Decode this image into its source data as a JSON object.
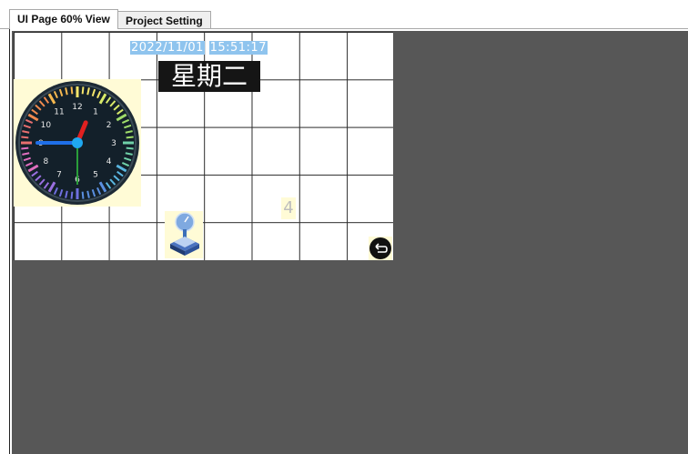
{
  "tabs": [
    {
      "label": "UI Page 60% View",
      "active": true
    },
    {
      "label": "Project Setting",
      "active": false
    }
  ],
  "canvas": {
    "date": "2022/11/01",
    "time": "15:51:17",
    "weekday": "星期二",
    "number_widget": "4",
    "clock_numerals": [
      "12",
      "1",
      "2",
      "3",
      "4",
      "5",
      "6",
      "7",
      "8",
      "9",
      "10",
      "11"
    ],
    "clock_time": {
      "hour": 12,
      "minute": 45,
      "second": 30
    }
  },
  "colors": {
    "workspace_bg": "#575757",
    "widget_highlight": "#fffbd6",
    "datetime_highlight": "#8fc4ee",
    "hour_hand": "#e02020",
    "minute_hand": "#1f6fe8",
    "second_hand": "#2a9d3a"
  },
  "icons": {
    "clock": "analog-clock-icon",
    "joystick": "joystick-icon",
    "back": "back-arrow-icon"
  }
}
